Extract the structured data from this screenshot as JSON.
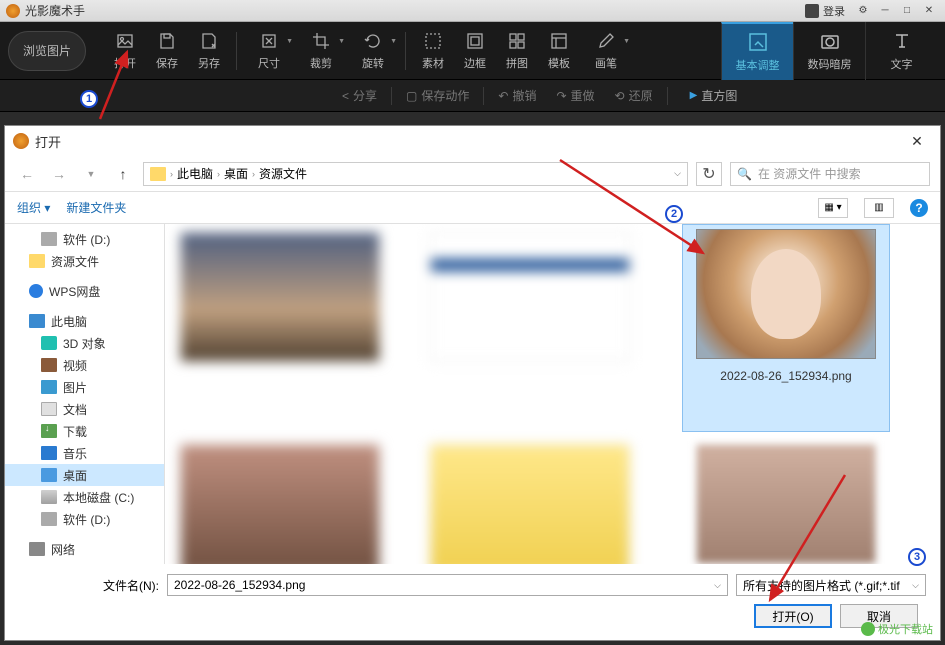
{
  "app": {
    "title": "光影魔术手",
    "login": "登录"
  },
  "toolbar": {
    "browse": "浏览图片",
    "items": [
      "打开",
      "保存",
      "另存",
      "尺寸",
      "裁剪",
      "旋转",
      "素材",
      "边框",
      "拼图",
      "模板",
      "画笔"
    ],
    "tabs": {
      "basic": "基本调整",
      "darkroom": "数码暗房",
      "text": "文字"
    }
  },
  "subbar": {
    "share": "分享",
    "save_action": "保存动作",
    "undo": "撤销",
    "redo": "重做",
    "restore": "还原",
    "histogram": "直方图"
  },
  "dialog": {
    "title": "打开",
    "breadcrumb": {
      "root": "此电脑",
      "p1": "桌面",
      "p2": "资源文件"
    },
    "search_placeholder": "在 资源文件 中搜索",
    "organize": "组织",
    "new_folder": "新建文件夹",
    "tree": {
      "software_d": "软件 (D:)",
      "resources": "资源文件",
      "wps": "WPS网盘",
      "pc": "此电脑",
      "obj3d": "3D 对象",
      "video": "视频",
      "pictures": "图片",
      "docs": "文档",
      "downloads": "下载",
      "music": "音乐",
      "desktop": "桌面",
      "local_c": "本地磁盘 (C:)",
      "software_d2": "软件 (D:)",
      "network": "网络"
    },
    "selected_file": "2022-08-26_152934.png",
    "filename_label": "文件名(N):",
    "filename_value": "2022-08-26_152934.png",
    "filter": "所有支持的图片格式 (*.gif;*.tif",
    "open_btn": "打开(O)",
    "cancel_btn": "取消"
  },
  "annotations": {
    "n1": "1",
    "n2": "2",
    "n3": "3"
  },
  "watermark": "极光下载站"
}
